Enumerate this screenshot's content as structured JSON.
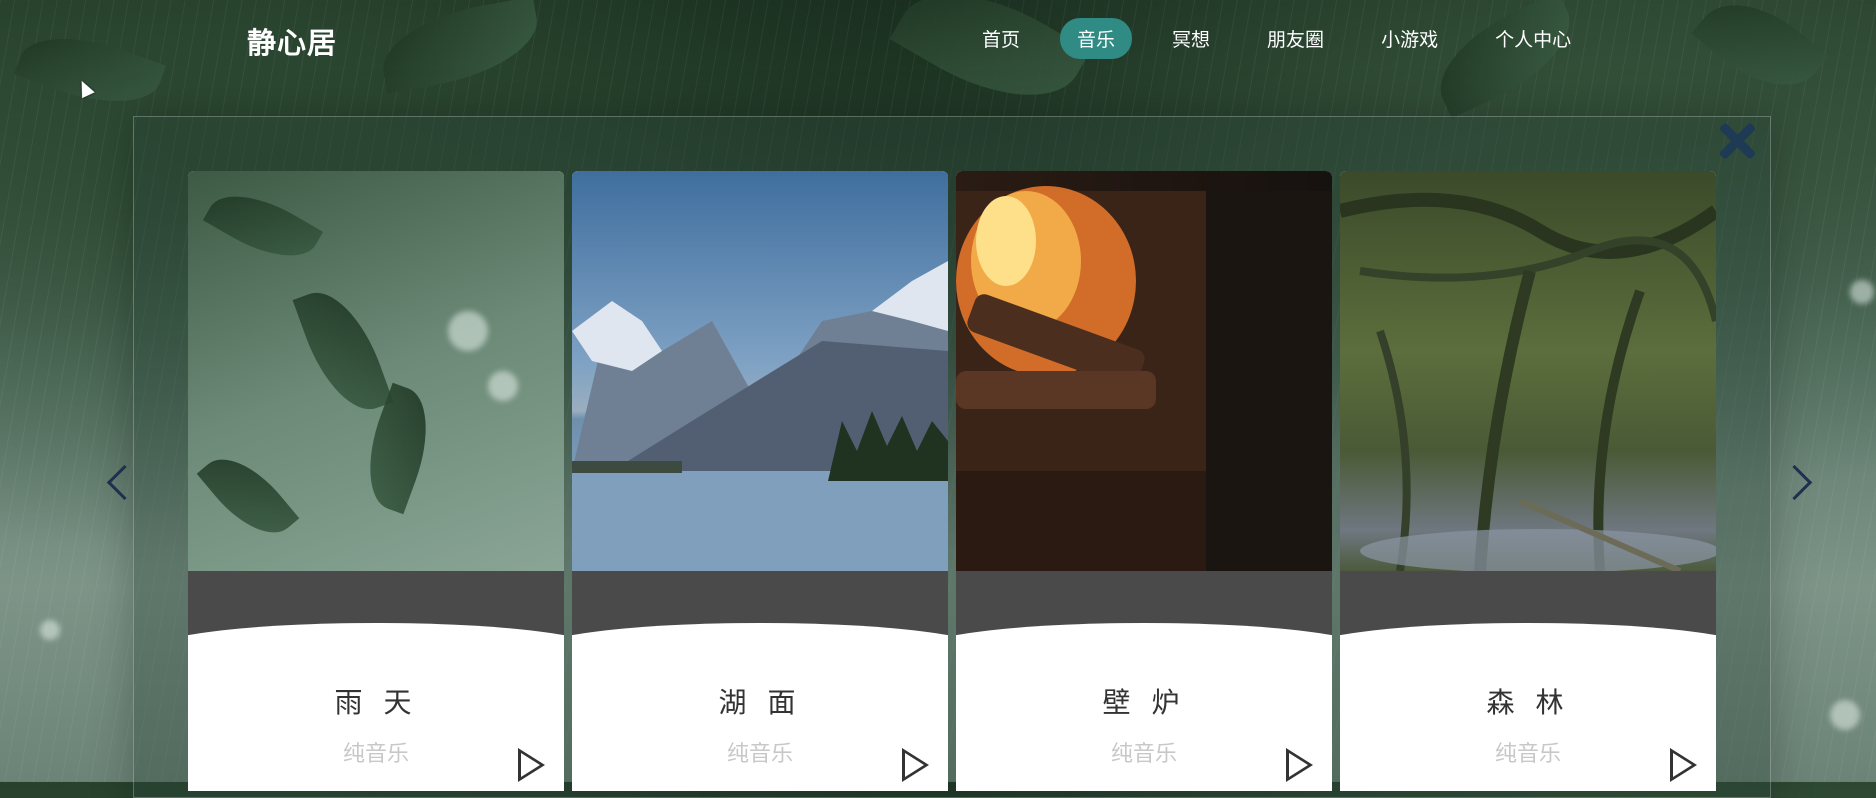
{
  "app": {
    "logo": "静心居"
  },
  "nav": {
    "items": [
      {
        "label": "首页",
        "active": false
      },
      {
        "label": "音乐",
        "active": true
      },
      {
        "label": "冥想",
        "active": false
      },
      {
        "label": "朋友圈",
        "active": false
      },
      {
        "label": "小游戏",
        "active": false
      },
      {
        "label": "个人中心",
        "active": false
      }
    ]
  },
  "cards": [
    {
      "title": "雨 天",
      "subtitle": "纯音乐",
      "scene": "rain"
    },
    {
      "title": "湖 面",
      "subtitle": "纯音乐",
      "scene": "lake"
    },
    {
      "title": "壁 炉",
      "subtitle": "纯音乐",
      "scene": "fireplace"
    },
    {
      "title": "森 林",
      "subtitle": "纯音乐",
      "scene": "forest"
    }
  ],
  "icons": {
    "close": "close-icon",
    "prev": "chevron-left-icon",
    "next": "chevron-right-icon",
    "play": "play-icon"
  },
  "colors": {
    "active_nav": "#2f8b84",
    "close_icon": "#1e3a55"
  }
}
